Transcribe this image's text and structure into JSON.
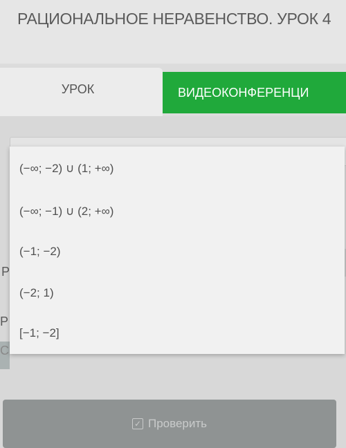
{
  "header": {
    "title": "РАЦИОНАЛЬНОЕ НЕРАВЕНСТВО. УРОК 4"
  },
  "tabs": [
    {
      "label": "УРОК",
      "active": false
    },
    {
      "label": "ВИДЕОКОНФЕРЕНЦИ",
      "active": true
    }
  ],
  "dropdown": {
    "options": [
      "(−∞; −2) ∪ (1; +∞)",
      "(−∞; −1) ∪ (2; +∞)",
      "(−1; −2)",
      "(−2; 1)",
      "[−1; −2]"
    ]
  },
  "background_letters": [
    "Р",
    "Р",
    "С"
  ],
  "check_button": {
    "label": "Проверить",
    "icon": "checkbox-icon"
  },
  "colors": {
    "accent_green": "#20a93b",
    "button_disabled": "#8f9393"
  }
}
